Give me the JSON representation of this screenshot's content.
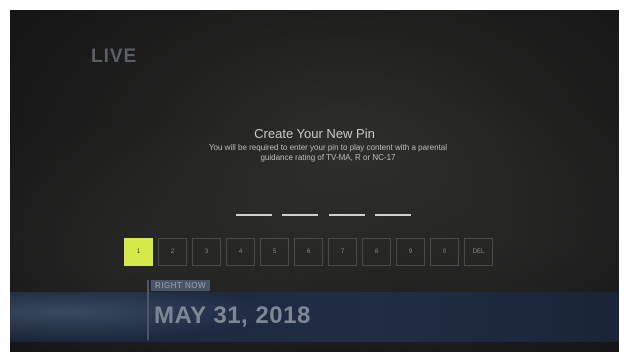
{
  "header": {
    "logo_text": "LIVE"
  },
  "dialog": {
    "title": "Create Your New Pin",
    "subtitle_line1": "You will be required to enter your pin to play content with a parental",
    "subtitle_line2": "guidance rating of TV-MA, R or NC-17",
    "pin_slots": 4
  },
  "keypad": {
    "keys": [
      "1",
      "2",
      "3",
      "4",
      "5",
      "6",
      "7",
      "8",
      "9",
      "0",
      "DEL"
    ],
    "selected_key": "1"
  },
  "bottom_bar": {
    "label": "RIGHT NOW",
    "date": "MAY 31, 2018"
  },
  "colors": {
    "accent": "#d6e94a",
    "background": "#1f1f1e",
    "band": "#1d2a42"
  }
}
